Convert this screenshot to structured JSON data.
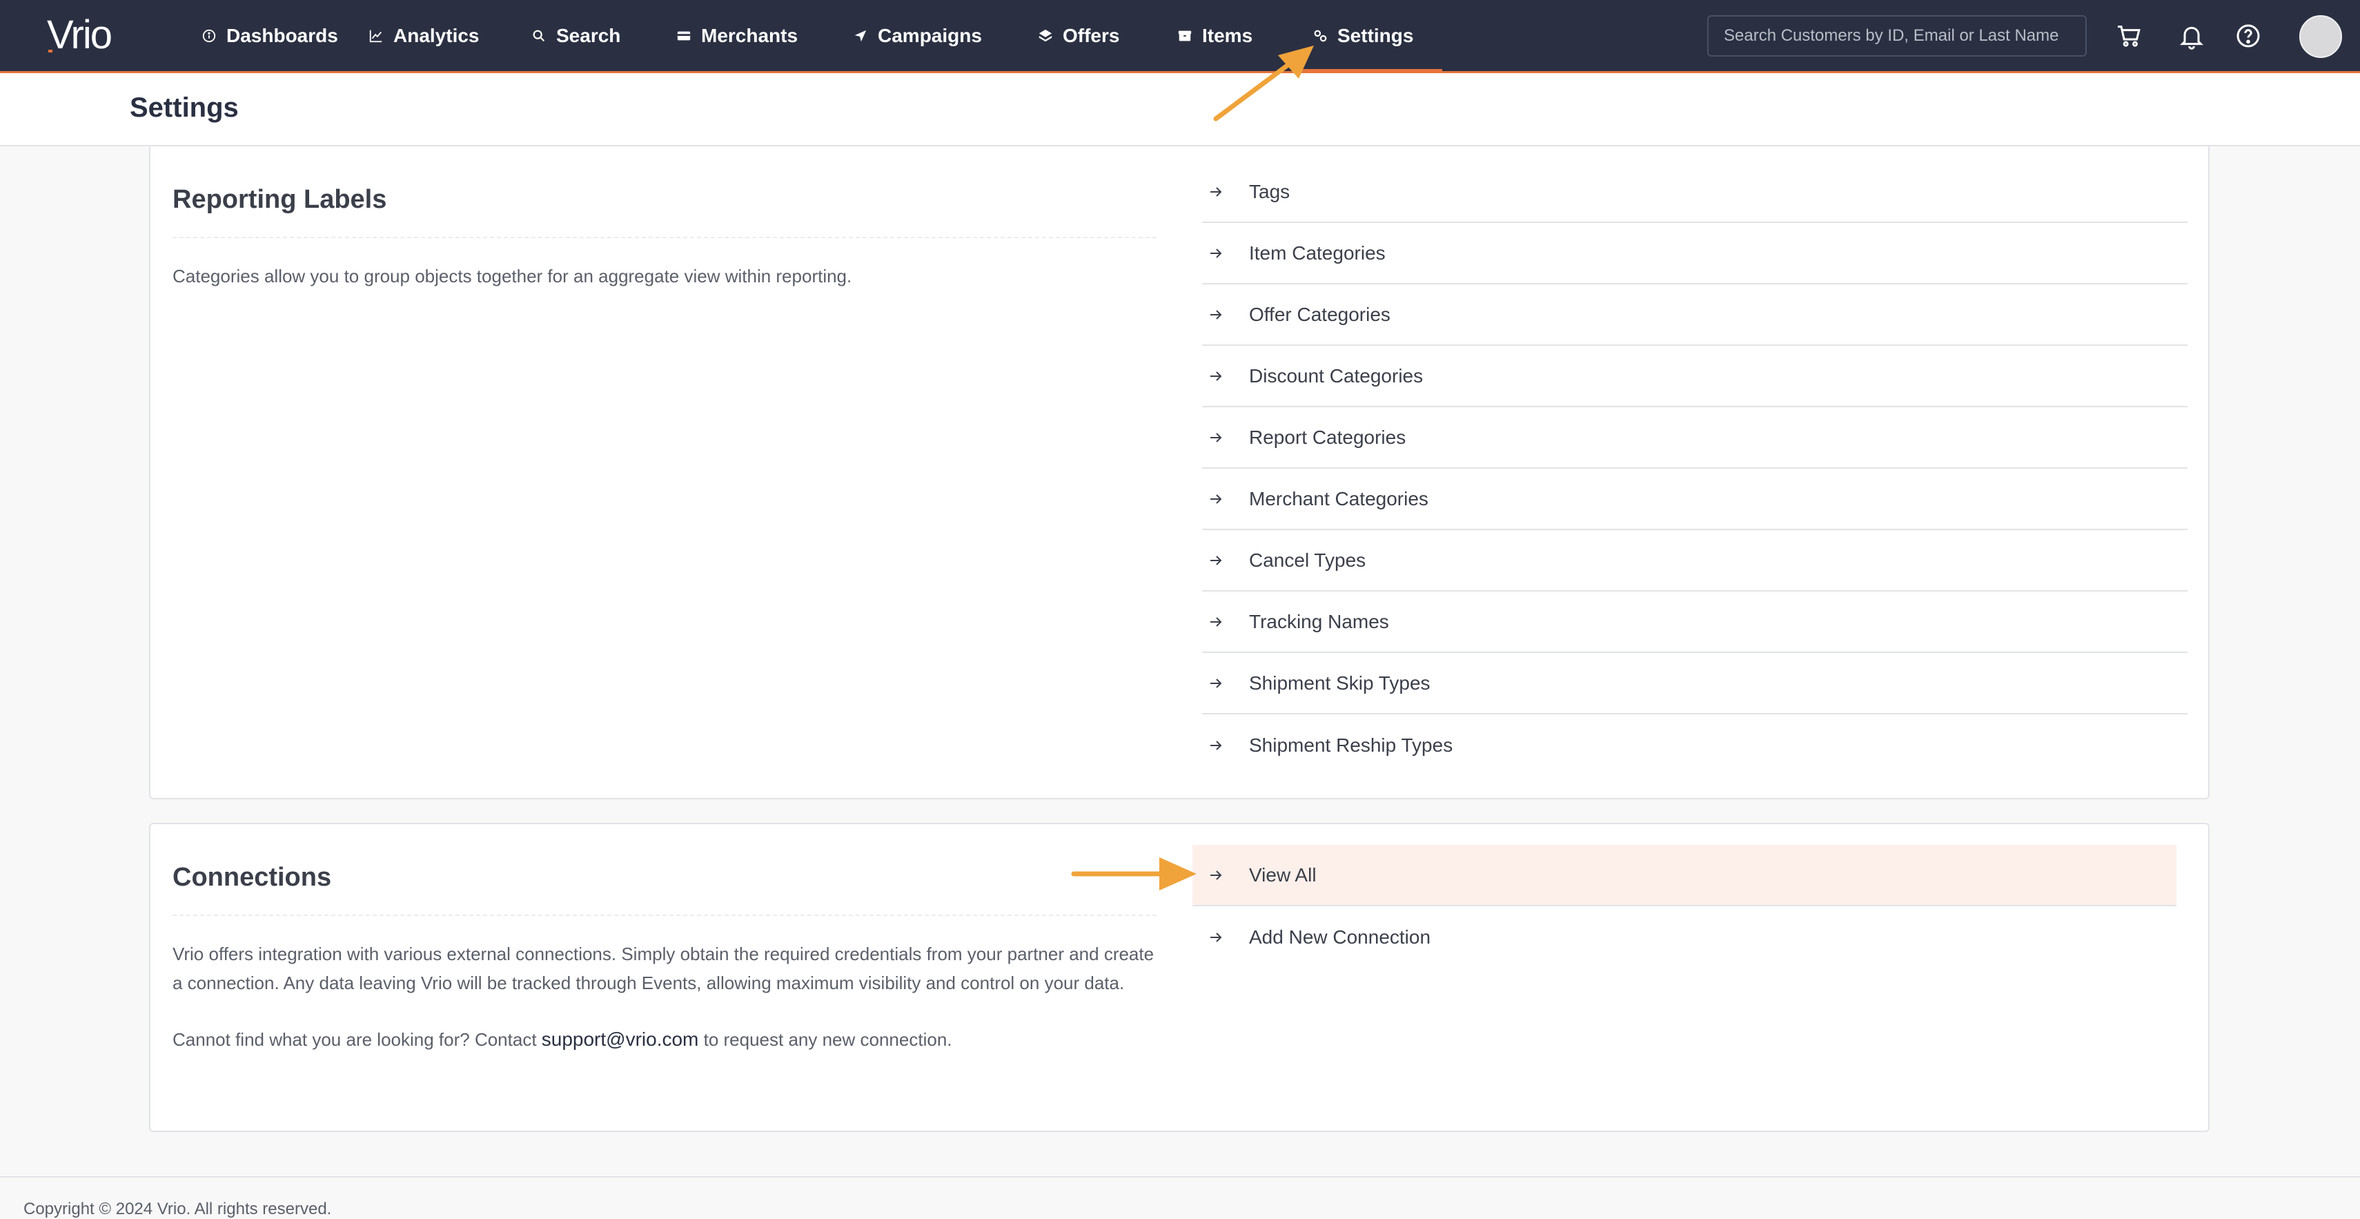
{
  "app": {
    "name": "Vrio"
  },
  "nav": {
    "items": [
      {
        "label": "Dashboards",
        "icon": "info-circle-icon"
      },
      {
        "label": "Analytics",
        "icon": "line-chart-icon"
      },
      {
        "label": "Search",
        "icon": "search-icon"
      },
      {
        "label": "Merchants",
        "icon": "credit-card-icon"
      },
      {
        "label": "Campaigns",
        "icon": "send-icon"
      },
      {
        "label": "Offers",
        "icon": "layers-icon"
      },
      {
        "label": "Items",
        "icon": "box-icon"
      },
      {
        "label": "Settings",
        "icon": "settings-icon",
        "active": true
      }
    ],
    "search_placeholder": "Search Customers by ID, Email or Last Name",
    "accent_color": "#e8743b",
    "bg_color": "#2a3042"
  },
  "page": {
    "title": "Settings"
  },
  "reporting": {
    "heading": "Reporting Labels",
    "description": "Categories allow you to group objects together for an aggregate view within reporting.",
    "links": [
      "Tags",
      "Item Categories",
      "Offer Categories",
      "Discount Categories",
      "Report Categories",
      "Merchant Categories",
      "Cancel Types",
      "Tracking Names",
      "Shipment Skip Types",
      "Shipment Reship Types"
    ]
  },
  "connections": {
    "heading": "Connections",
    "description": "Vrio offers integration with various external connections. Simply obtain the required credentials from your partner and create a connection. Any data leaving Vrio will be tracked through Events, allowing maximum visibility and control on your data.",
    "contact_prefix": "Cannot find what you are looking for? Contact ",
    "contact_email": "support@vrio.com",
    "contact_suffix": " to request any new connection.",
    "links": [
      "View All",
      "Add New Connection"
    ],
    "highlighted_link": "View All"
  },
  "footer": {
    "text": "Copyright © 2024 Vrio. All rights reserved."
  },
  "annotation_color": "#f0a33a"
}
